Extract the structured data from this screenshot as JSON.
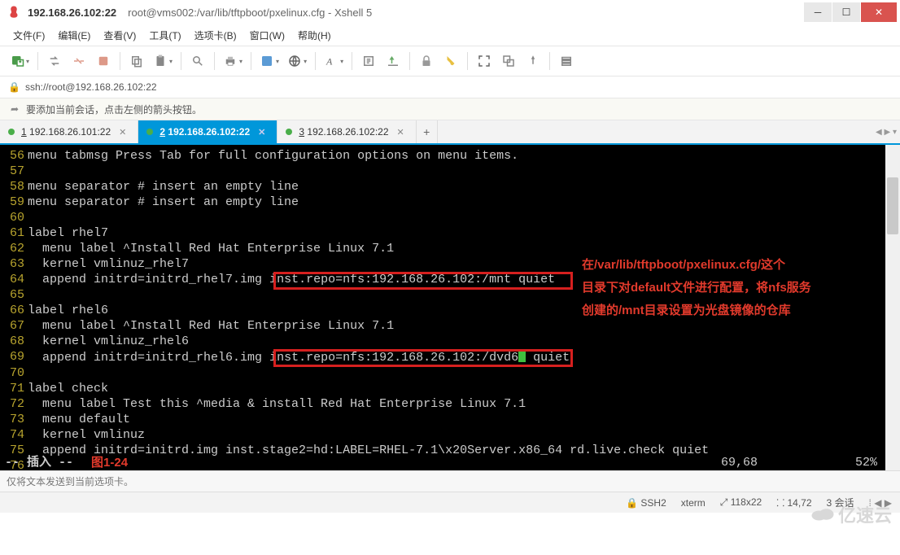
{
  "title": {
    "session": "192.168.26.102:22",
    "path": "root@vms002:/var/lib/tftpboot/pxelinux.cfg - Xshell 5"
  },
  "menu": {
    "file": "文件(F)",
    "edit": "编辑(E)",
    "view": "查看(V)",
    "tools": "工具(T)",
    "tabs": "选项卡(B)",
    "window": "窗口(W)",
    "help": "帮助(H)"
  },
  "address": "ssh://root@192.168.26.102:22",
  "tip": "要添加当前会话，点击左侧的箭头按钮。",
  "tabs": [
    {
      "num": "1",
      "label": "192.168.26.101:22",
      "active": false
    },
    {
      "num": "2",
      "label": "192.168.26.102:22",
      "active": true
    },
    {
      "num": "3",
      "label": "192.168.26.102:22",
      "active": false
    }
  ],
  "lines": {
    "56": "menu tabmsg Press Tab for full configuration options on menu items.",
    "57": "",
    "58": "menu separator # insert an empty line",
    "59": "menu separator # insert an empty line",
    "60": "",
    "61": "label rhel7",
    "62": "  menu label ^Install Red Hat Enterprise Linux 7.1",
    "63": "  kernel vmlinuz_rhel7",
    "64a": "  append initrd=initrd_rhel7.img ",
    "64b": "inst.repo=nfs:192.168.26.102:/mnt quiet",
    "65": "",
    "66": "label rhel6",
    "67": "  menu label ^Install Red Hat Enterprise Linux 7.1",
    "68": "  kernel vmlinuz_rhel6",
    "69a": "  append initrd=initrd_rhel6.img ",
    "69b": "inst.repo=nfs:192.168.26.102:/dvd6",
    "69c": " quiet",
    "70": "",
    "71": "label check",
    "72": "  menu label Test this ^media & install Red Hat Enterprise Linux 7.1",
    "73": "  menu default",
    "74": "  kernel vmlinuz",
    "75": "  append initrd=initrd.img inst.stage2=hd:LABEL=RHEL-7.1\\x20Server.x86_64 rd.live.check quiet",
    "76": ""
  },
  "annotation": {
    "l1": "在/var/lib/tftpboot/pxelinux.cfg/这个",
    "l2": "目录下对default文件进行配置，将nfs服务",
    "l3": "创建的/mnt目录设置为光盘镜像的仓库"
  },
  "vim": {
    "mode": "-- 插入 --",
    "figlabel": "图1-24",
    "position": "69,68",
    "percent": "52%"
  },
  "sendbar": "仅将文本发送到当前选项卡。",
  "status": {
    "proto": "SSH2",
    "term": "xterm",
    "size": "118x22",
    "cursor": "14,72",
    "sessions": "3 会话"
  },
  "watermark": "亿速云"
}
